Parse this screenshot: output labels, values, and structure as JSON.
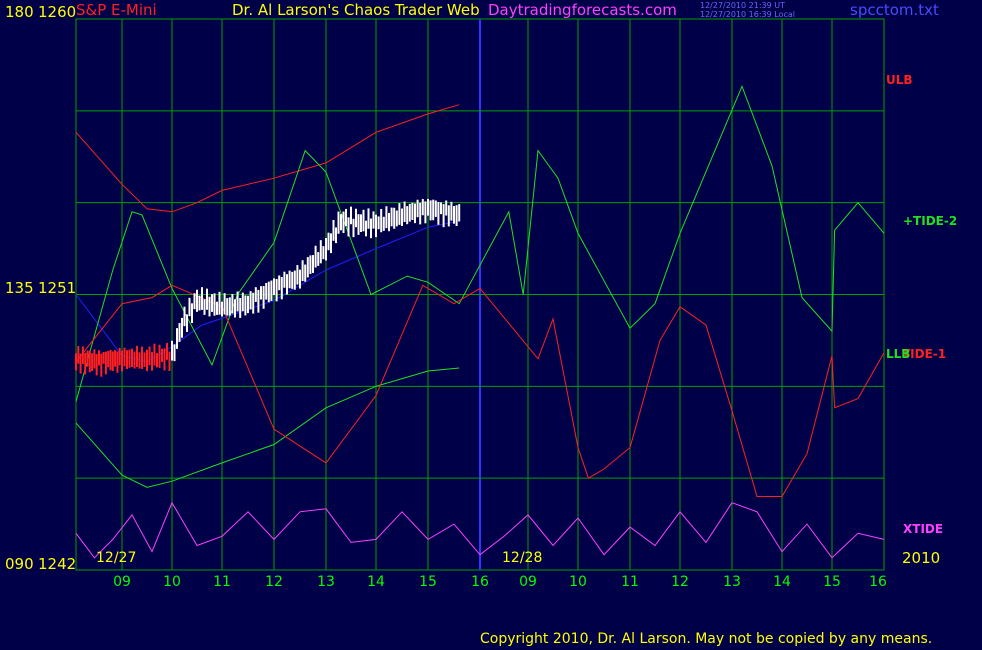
{
  "header": {
    "symbol": "S&P E-Mini",
    "title": "Dr. Al Larson's Chaos Trader Web",
    "site": "Daytradingforecasts.com",
    "stamp_ut": "12/27/2010 21:39 UT",
    "stamp_local": "12/27/2010 16:39 Local",
    "file": "spcctom.txt"
  },
  "y_labels": {
    "top_left": "180",
    "top_price": "1260",
    "mid_left": "135",
    "mid_price": "1251",
    "bot_left": "090",
    "bot_price": "1242"
  },
  "dates": {
    "day1": "12/27",
    "day2": "12/28",
    "year": "2010"
  },
  "legend": {
    "ulb": "ULB",
    "tide2": "+TIDE-2",
    "llb": "LLB",
    "tide1": "TIDE-1",
    "xtide": "XTIDE"
  },
  "footer": {
    "copyright": "Copyright 2010, Dr. Al Larson.  May not be copied by any means."
  },
  "colors": {
    "background": "#000048",
    "grid": "#00a000",
    "divider": "#3333ff",
    "price": "#ffffff",
    "price_early": "#ff2020",
    "ulb": "#ff2020",
    "llb": "#20e020",
    "tide2": "#20e020",
    "tide1": "#ff2020",
    "average": "#2020ff",
    "xtide": "#ff40ff",
    "symbol": "#ff2020",
    "title": "#ffff00",
    "site": "#ff40ff",
    "file": "#4a4aff",
    "x_tick": "#00ff00",
    "date": "#ffff00"
  },
  "chart_data": {
    "type": "line",
    "title": "S&P E-Mini",
    "y_right": {
      "min": 1242,
      "max": 1260,
      "ticks": [
        1242,
        1251,
        1260
      ]
    },
    "y_left": {
      "min": 90,
      "max": 180,
      "ticks": [
        90,
        135,
        180
      ]
    },
    "x_ticks": [
      "09",
      "10",
      "11",
      "12",
      "13",
      "14",
      "15",
      "16",
      "09",
      "10",
      "11",
      "12",
      "13",
      "14",
      "15",
      "16"
    ],
    "grid": true,
    "series": [
      {
        "name": "ULB",
        "values": [
          [
            0,
            1256.3
          ],
          [
            1,
            1254.6
          ],
          [
            1.5,
            1253.8
          ],
          [
            2,
            1253.7
          ],
          [
            2.5,
            1254.0
          ],
          [
            3,
            1254.4
          ],
          [
            4,
            1254.8
          ],
          [
            5,
            1255.3
          ],
          [
            6,
            1256.3
          ],
          [
            7,
            1256.9
          ],
          [
            7.6,
            1257.2
          ]
        ]
      },
      {
        "name": "LLB",
        "values": [
          [
            0,
            1246.8
          ],
          [
            1,
            1245.1
          ],
          [
            1.5,
            1244.7
          ],
          [
            2,
            1244.9
          ],
          [
            3,
            1245.5
          ],
          [
            4,
            1246.1
          ],
          [
            5,
            1247.3
          ],
          [
            6,
            1248.0
          ],
          [
            7,
            1248.5
          ],
          [
            7.6,
            1248.6
          ]
        ]
      },
      {
        "name": "average",
        "values": [
          [
            0,
            1251.0
          ],
          [
            1,
            1249.0
          ],
          [
            1.5,
            1248.8
          ],
          [
            2,
            1249.3
          ],
          [
            2.6,
            1250.0
          ],
          [
            4,
            1250.8
          ],
          [
            5,
            1251.8
          ],
          [
            6,
            1252.5
          ],
          [
            7,
            1253.2
          ],
          [
            7.6,
            1253.4
          ]
        ]
      },
      {
        "name": "+TIDE-2",
        "values": [
          [
            0,
            1247.5
          ],
          [
            0.8,
            1251.8
          ],
          [
            1.2,
            1253.7
          ],
          [
            1.4,
            1253.6
          ],
          [
            2,
            1251.2
          ],
          [
            2.8,
            1248.7
          ],
          [
            3.3,
            1251.0
          ],
          [
            4,
            1252.7
          ],
          [
            4.6,
            1255.7
          ],
          [
            5,
            1255.0
          ],
          [
            5.9,
            1251.0
          ],
          [
            6.6,
            1251.6
          ],
          [
            7,
            1251.4
          ],
          [
            7.6,
            1250.7
          ],
          [
            8.6,
            1253.7
          ],
          [
            8.9,
            1251.0
          ],
          [
            9.2,
            1255.7
          ],
          [
            9.6,
            1254.8
          ],
          [
            10,
            1253.0
          ],
          [
            11,
            1249.9
          ],
          [
            11.5,
            1250.7
          ],
          [
            12,
            1253.0
          ],
          [
            13.2,
            1257.8
          ],
          [
            13.8,
            1255.2
          ],
          [
            14.4,
            1250.9
          ],
          [
            15,
            1249.8
          ],
          [
            15.05,
            1253.1
          ],
          [
            15.5,
            1254.0
          ],
          [
            16,
            1253.0
          ]
        ]
      },
      {
        "name": "TIDE-1",
        "values": [
          [
            0,
            1248.8
          ],
          [
            1,
            1250.7
          ],
          [
            1.6,
            1250.9
          ],
          [
            2,
            1251.3
          ],
          [
            3,
            1250.6
          ],
          [
            4,
            1246.6
          ],
          [
            5,
            1245.5
          ],
          [
            6,
            1247.7
          ],
          [
            6.9,
            1251.3
          ],
          [
            7.5,
            1250.7
          ],
          [
            8,
            1251.2
          ],
          [
            9.2,
            1248.9
          ],
          [
            9.5,
            1250.2
          ],
          [
            10,
            1246.0
          ],
          [
            10.2,
            1245.0
          ],
          [
            10.5,
            1245.3
          ],
          [
            11,
            1246.0
          ],
          [
            11.6,
            1249.5
          ],
          [
            12,
            1250.6
          ],
          [
            12.5,
            1250.0
          ],
          [
            13,
            1247.2
          ],
          [
            13.5,
            1244.4
          ],
          [
            14,
            1244.4
          ],
          [
            14.5,
            1245.8
          ],
          [
            15,
            1249.0
          ],
          [
            15.05,
            1247.3
          ],
          [
            15.5,
            1247.6
          ],
          [
            16,
            1249.1
          ]
        ]
      },
      {
        "name": "XTIDE",
        "values": [
          [
            0,
            1243.2
          ],
          [
            0.4,
            1242.4
          ],
          [
            0.8,
            1243.0
          ],
          [
            1.2,
            1243.8
          ],
          [
            1.6,
            1242.6
          ],
          [
            2,
            1244.2
          ],
          [
            2.5,
            1242.8
          ],
          [
            3,
            1243.1
          ],
          [
            3.5,
            1243.9
          ],
          [
            4,
            1243.0
          ],
          [
            4.5,
            1243.9
          ],
          [
            5,
            1244.0
          ],
          [
            5.5,
            1242.9
          ],
          [
            6,
            1243.0
          ],
          [
            6.5,
            1243.9
          ],
          [
            7,
            1243.0
          ],
          [
            7.5,
            1243.5
          ],
          [
            8,
            1242.5
          ],
          [
            8.5,
            1243.1
          ],
          [
            9,
            1243.8
          ],
          [
            9.5,
            1242.8
          ],
          [
            10,
            1243.7
          ],
          [
            10.5,
            1242.5
          ],
          [
            11,
            1243.4
          ],
          [
            11.5,
            1242.8
          ],
          [
            12,
            1243.9
          ],
          [
            12.5,
            1242.9
          ],
          [
            13,
            1244.2
          ],
          [
            13.5,
            1243.9
          ],
          [
            14,
            1242.6
          ],
          [
            14.5,
            1243.5
          ],
          [
            15,
            1242.4
          ],
          [
            15.5,
            1243.2
          ],
          [
            16,
            1243.0
          ]
        ]
      },
      {
        "name": "price",
        "values": [
          [
            0,
            1248.9
          ],
          [
            0.5,
            1248.8
          ],
          [
            1,
            1248.9
          ],
          [
            1.5,
            1248.9
          ],
          [
            2,
            1249.0
          ],
          [
            2.2,
            1250.0
          ],
          [
            2.5,
            1250.8
          ],
          [
            3,
            1250.6
          ],
          [
            3.5,
            1250.7
          ],
          [
            4,
            1251.2
          ],
          [
            4.5,
            1251.6
          ],
          [
            5,
            1252.5
          ],
          [
            5.3,
            1253.4
          ],
          [
            6,
            1253.3
          ],
          [
            6.5,
            1253.6
          ],
          [
            7,
            1253.8
          ],
          [
            7.6,
            1253.6
          ]
        ]
      }
    ]
  }
}
